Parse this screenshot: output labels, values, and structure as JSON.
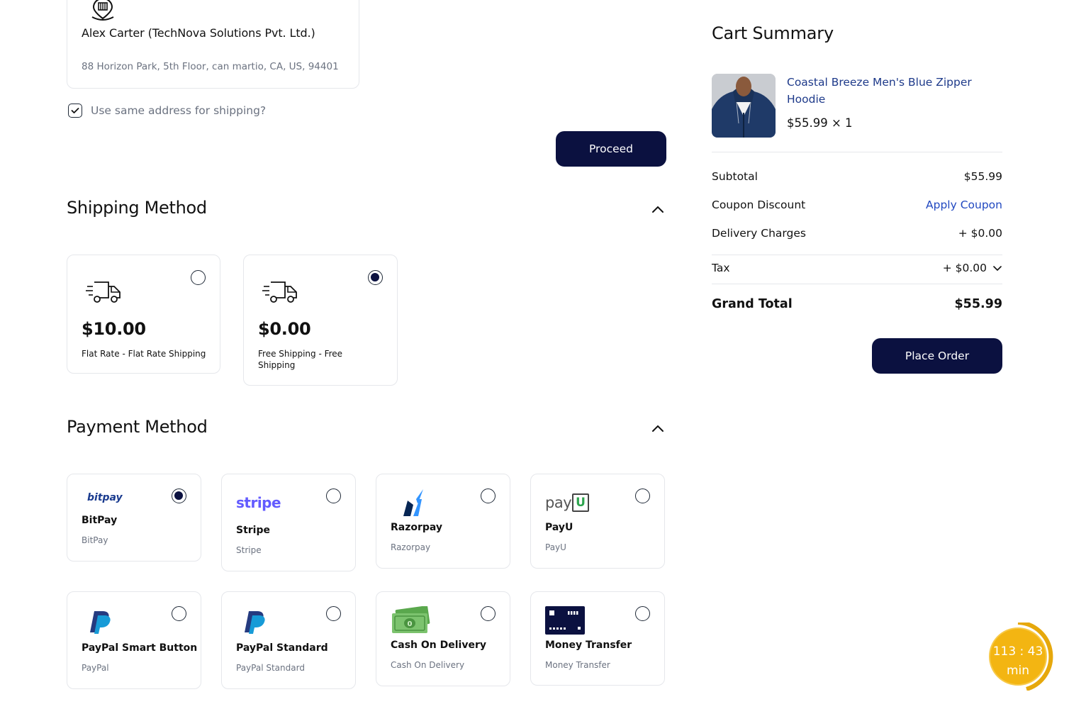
{
  "billing": {
    "name": "Alex Carter (TechNova Solutions Pvt. Ltd.)",
    "address": "88 Horizon Park, 5th Floor, can martio, CA, US, 94401",
    "same_shipping_label": "Use same address for shipping?",
    "same_shipping_checked": true,
    "proceed_label": "Proceed"
  },
  "shipping": {
    "title": "Shipping Method",
    "options": [
      {
        "price": "$10.00",
        "description": "Flat Rate - Flat Rate Shipping",
        "selected": false
      },
      {
        "price": "$0.00",
        "description": "Free Shipping - Free Shipping",
        "selected": true
      }
    ]
  },
  "payment": {
    "title": "Payment Method",
    "options": [
      {
        "logo_text": "bitpay",
        "name": "BitPay",
        "sub": "BitPay",
        "selected": true
      },
      {
        "logo_text": "stripe",
        "name": "Stripe",
        "sub": "Stripe",
        "selected": false
      },
      {
        "logo_text": "",
        "name": "Razorpay",
        "sub": "Razorpay",
        "selected": false
      },
      {
        "logo_text": "pay",
        "logo_text_2": "U",
        "name": "PayU",
        "sub": "PayU",
        "selected": false
      },
      {
        "logo_text": "",
        "name": "PayPal Smart Button",
        "sub": "PayPal",
        "selected": false
      },
      {
        "logo_text": "",
        "name": "PayPal Standard",
        "sub": "PayPal Standard",
        "selected": false
      },
      {
        "logo_text": "",
        "name": "Cash On Delivery",
        "sub": "Cash On Delivery",
        "selected": false
      },
      {
        "logo_text": "",
        "name": "Money Transfer",
        "sub": "Money Transfer",
        "selected": false
      }
    ]
  },
  "cart": {
    "title": "Cart Summary",
    "product": {
      "name": "Coastal Breeze Men's Blue Zipper Hoodie",
      "price_qty": "$55.99 × 1"
    },
    "subtotal_label": "Subtotal",
    "subtotal_value": "$55.99",
    "coupon_label": "Coupon Discount",
    "coupon_action": "Apply Coupon",
    "delivery_label": "Delivery Charges",
    "delivery_value": "+ $0.00",
    "tax_label": "Tax",
    "tax_value": "+ $0.00",
    "grand_total_label": "Grand Total",
    "grand_total_value": "$55.99",
    "place_order_label": "Place Order"
  },
  "timer": {
    "time": "113 : 43",
    "unit": "min"
  },
  "colors": {
    "primary": "#0b1140",
    "link": "#2148c0",
    "muted": "#6b7280",
    "border": "#e5e7eb",
    "timer": "#f3b512"
  },
  "icons": [
    "map-pin-icon",
    "checkbox-check-icon",
    "chevron-up-icon",
    "truck-icon",
    "chevron-down-icon",
    "bitpay-logo",
    "stripe-logo",
    "razorpay-logo",
    "payu-logo",
    "paypal-logo",
    "cash-icon",
    "bank-card-icon"
  ]
}
